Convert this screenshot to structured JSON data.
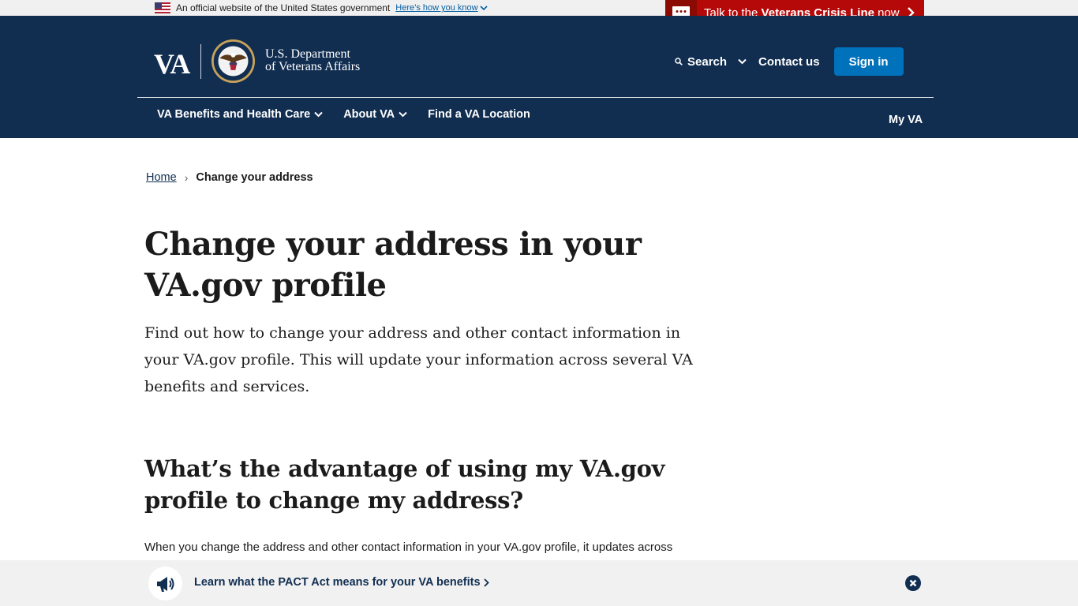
{
  "gov_banner": {
    "text": "An official website of the United States government",
    "link": "Here’s how you know"
  },
  "crisis_line": {
    "prefix": "Talk to the ",
    "bold": "Veterans Crisis Line",
    "suffix": " now"
  },
  "header": {
    "logo_text": "VA",
    "dept_line1": "U.S. Department",
    "dept_line2": "of Veterans Affairs",
    "search_label": "Search",
    "contact_label": "Contact us",
    "signin_label": "Sign in"
  },
  "nav": {
    "items": [
      {
        "label": "VA Benefits and Health Care"
      },
      {
        "label": "About VA"
      },
      {
        "label": "Find a VA Location"
      }
    ],
    "my_va": "My VA"
  },
  "breadcrumb": {
    "home": "Home",
    "separator": "›",
    "current": "Change your address"
  },
  "main": {
    "title": "Change your address in your VA.gov profile",
    "intro": "Find out how to change your address and other contact information in your VA.gov profile. This will update your information across several VA benefits and services.",
    "section_heading": "What’s the advantage of using my VA.gov profile to change my address?",
    "body": "When you change the address and other contact information in your VA.gov profile, it updates across"
  },
  "promo": {
    "link": "Learn what the PACT Act means for your VA benefits"
  },
  "colors": {
    "header_bg": "#112e51",
    "crisis_red": "#b50909",
    "signin_blue": "#0071bb",
    "link_blue": "#005ea2"
  }
}
